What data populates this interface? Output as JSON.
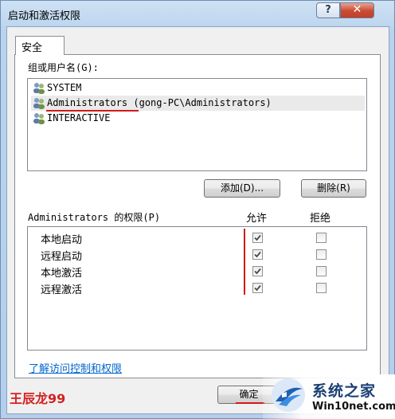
{
  "window": {
    "title": "启动和激活权限",
    "help_label": "?",
    "close_label": "✕"
  },
  "tabs": [
    {
      "label": "安全"
    }
  ],
  "groups": {
    "label": "组或用户名(G):",
    "items": [
      {
        "name": "SYSTEM",
        "detail": ""
      },
      {
        "name": "Administrators",
        "detail": " (gong-PC\\Administrators)"
      },
      {
        "name": "INTERACTIVE",
        "detail": ""
      }
    ],
    "add_button": "添加(D)...",
    "remove_button": "删除(R)"
  },
  "permissions": {
    "title": "Administrators 的权限(P)",
    "allow_header": "允许",
    "deny_header": "拒绝",
    "rows": [
      {
        "name": "本地启动",
        "allow": true,
        "deny": false
      },
      {
        "name": "远程启动",
        "allow": true,
        "deny": false
      },
      {
        "name": "本地激活",
        "allow": true,
        "deny": false
      },
      {
        "name": "远程激活",
        "allow": true,
        "deny": false
      }
    ]
  },
  "link_text": "了解访问控制和权限",
  "ok_button": "确定",
  "watermark": "王辰龙99",
  "brand": {
    "name": "系统之家",
    "url": "Win10net.com"
  },
  "colors": {
    "accent_red": "#d11a1a",
    "link": "#0066cc",
    "title_bg": "#b9d3ee"
  }
}
